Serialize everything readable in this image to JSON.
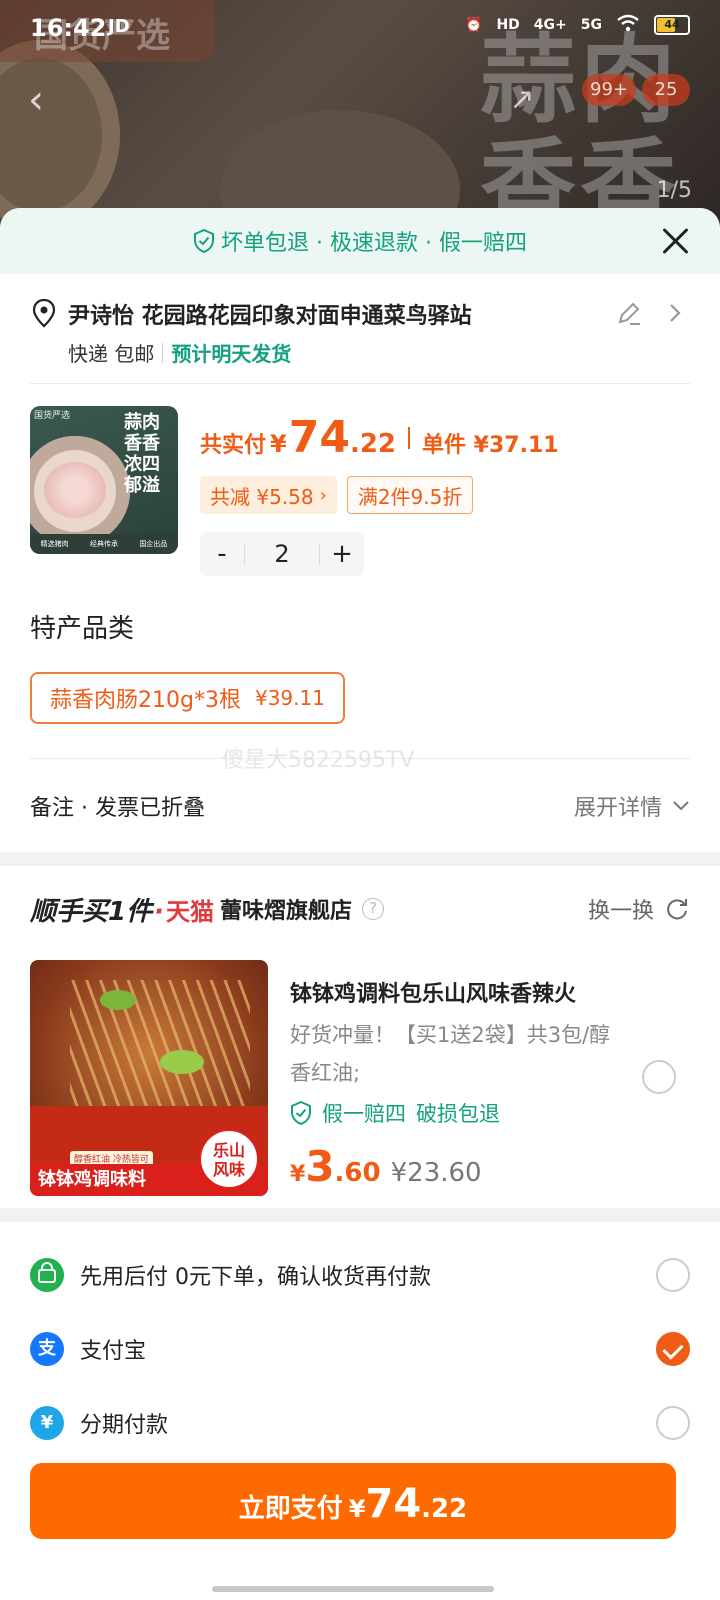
{
  "status_bar": {
    "time": "16:42",
    "carrier_tag": "JD",
    "network_hd": "HD",
    "network_4g": "4G+",
    "network_5g": "5G",
    "battery": "44"
  },
  "background": {
    "brand_text": "国货严选",
    "big_text": "蒜肉\n香香",
    "cart_badge": "99+",
    "msg_badge": "25",
    "image_counter": "1/5"
  },
  "guarantee": {
    "text": "坏单包退 · 极速退款 · 假一赔四"
  },
  "address": {
    "line": "尹诗怡 花园路花园印象对面申通菜鸟驿站",
    "delivery": "快递 包邮",
    "ship_time": "预计明天发货"
  },
  "product": {
    "image_text": "蒜肉\n香香\n浓四\n郁溢",
    "image_logo": "国货严选",
    "image_strip": [
      "精选猪肉",
      "经典传承",
      "国企出品"
    ],
    "total_label": "共实付",
    "currency": "¥",
    "total_int": "74",
    "total_dec": ".22",
    "unit_label": "单件 ¥37.11",
    "discount_chip": "共减 ¥5.58",
    "promo_chip": "满2件9.5折",
    "quantity": "2",
    "minus": "-",
    "plus": "+"
  },
  "category": {
    "title": "特产品类",
    "variant_name": "蒜香肉肠210g*3根",
    "variant_price": "¥39.11"
  },
  "watermark": "傻星大5822595TV",
  "remarks": {
    "label": "备注 · 发票已折叠",
    "expand": "展开详情"
  },
  "addon": {
    "title_a": "顺手买1件",
    "title_dot": "·",
    "platform": "天猫",
    "shop": "蕾味熠旗舰店",
    "help": "?",
    "swap": "换一换",
    "name": "钵钵鸡调料包乐山风味香辣火",
    "desc": "好货冲量！【买1送2袋】共3包/醇香红油;",
    "guard_a": "假一赔四",
    "guard_b": "破损包退",
    "currency": "¥",
    "price_int": "3",
    "price_dec": ".60",
    "old_price": "¥23.60",
    "img_banner": "钵钵鸡调味料",
    "img_tag": "醇香红油 冷热皆可",
    "img_seal": "乐山\n风味"
  },
  "payment": {
    "options": [
      {
        "label": "先用后付  0元下单，确认收货再付款",
        "icon": "wallet-icon",
        "color": "#21b14f",
        "checked": false
      },
      {
        "label": "支付宝",
        "icon": "alipay-icon",
        "color": "#1677ff",
        "checked": true
      },
      {
        "label": "分期付款",
        "icon": "installment-icon",
        "color": "#1ea6e8",
        "checked": false
      }
    ]
  },
  "pay_button": {
    "label": "立即支付",
    "currency": "¥",
    "int": "74",
    "dec": ".22"
  },
  "colors": {
    "accent": "#ff6a00",
    "price": "#f05b16",
    "green": "#13a180",
    "tmall": "#e4393c"
  }
}
